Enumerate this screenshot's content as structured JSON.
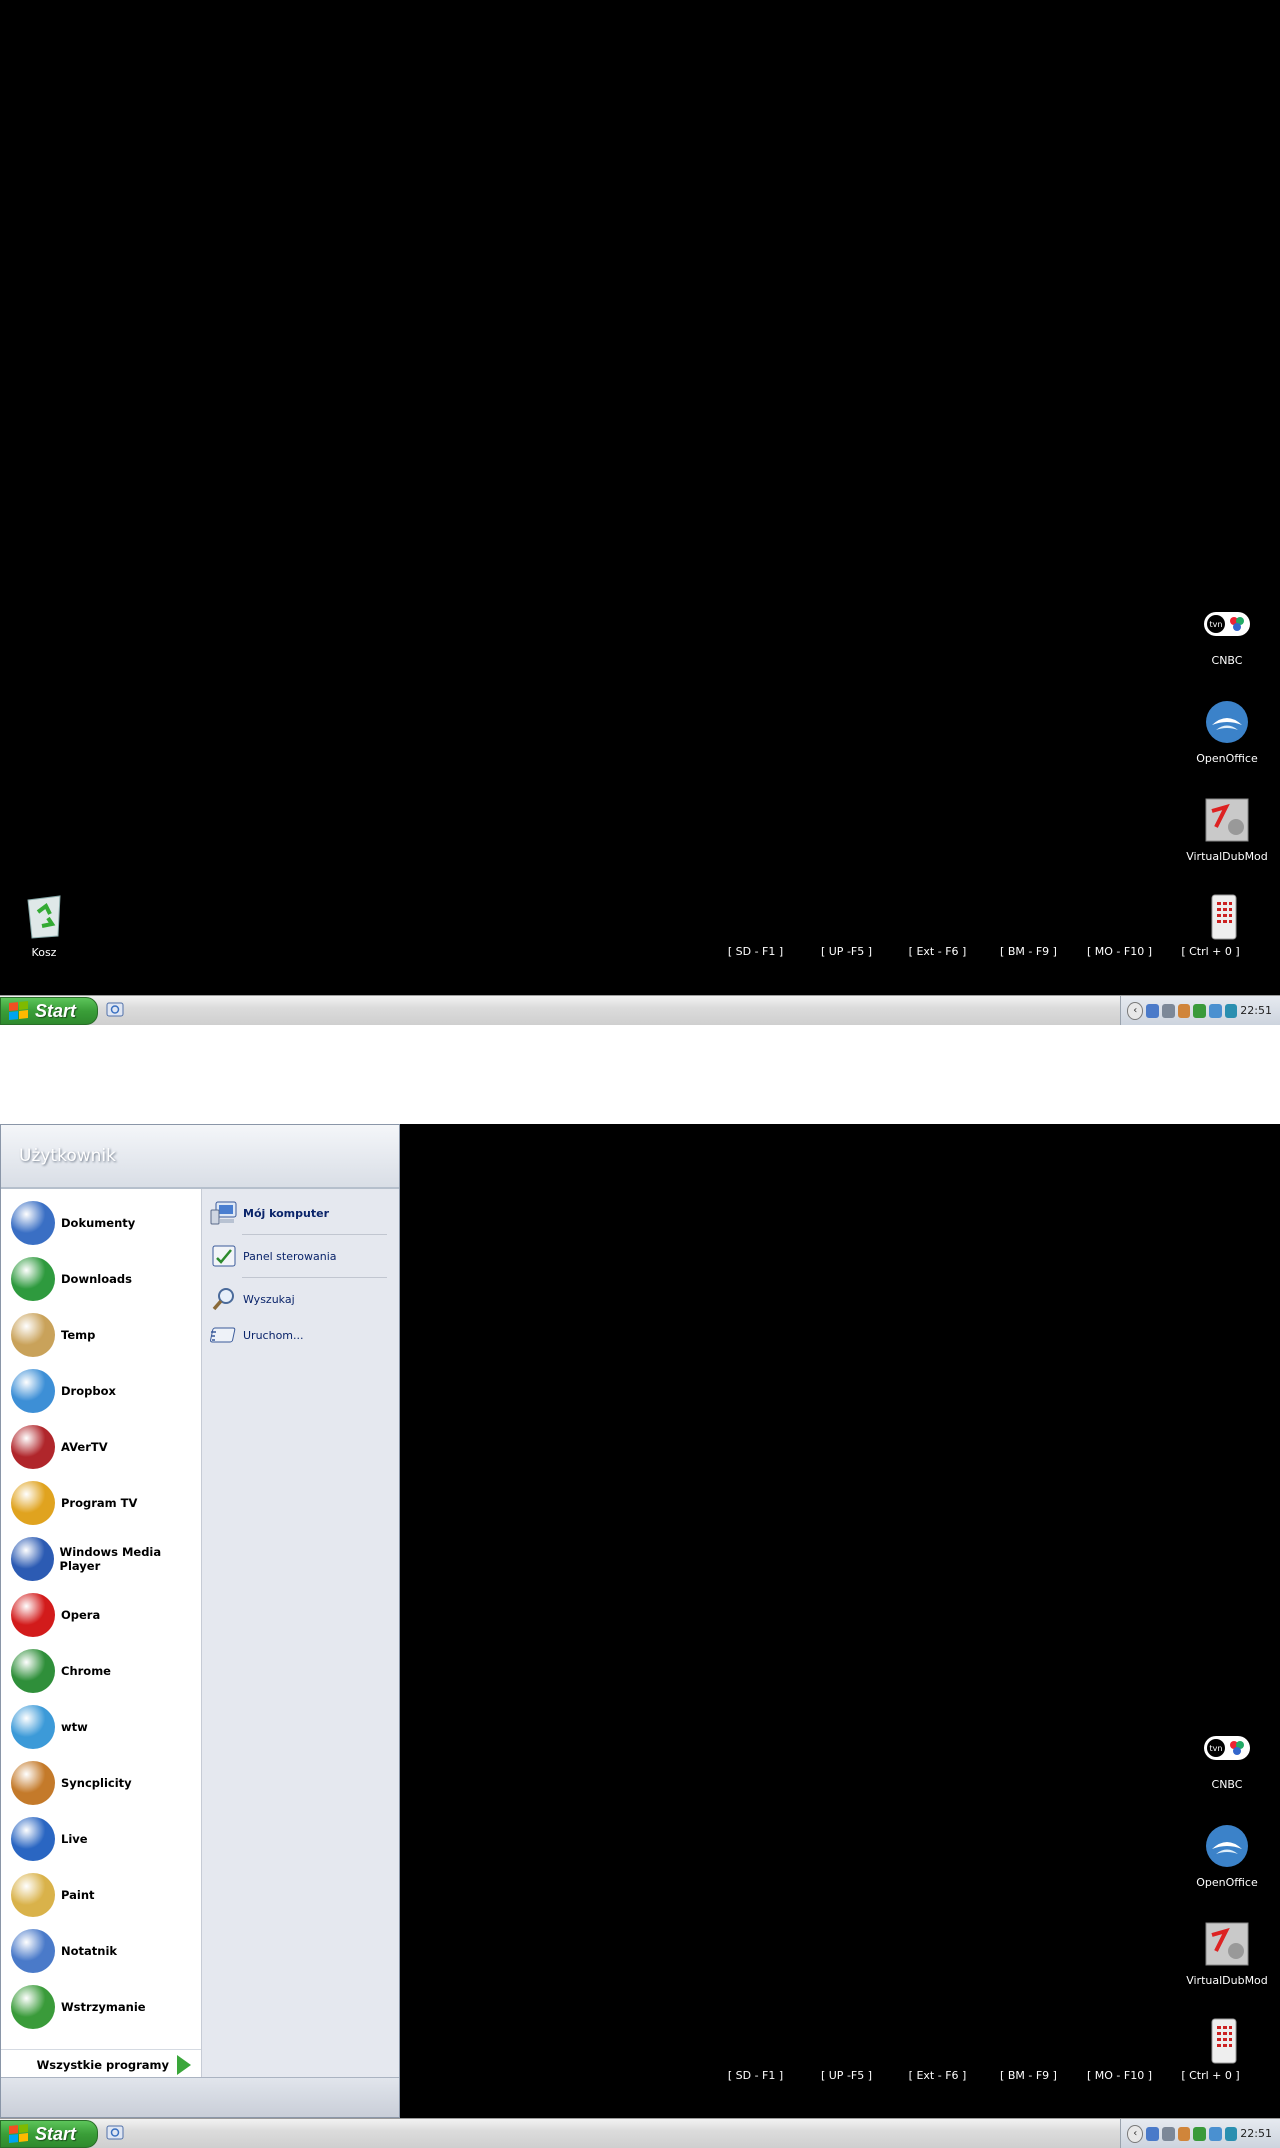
{
  "desktop": {
    "icons": [
      {
        "label": "CNBC",
        "icon": "tvn-cnbc-icon"
      },
      {
        "label": "OpenOffice",
        "icon": "openoffice-icon"
      },
      {
        "label": "VirtualDubMod",
        "icon": "virtualdubmod-icon"
      },
      {
        "label": "Kosz",
        "icon": "recycle-bin-icon"
      }
    ],
    "hotkeys": [
      "[ SD - F1 ]",
      "[ UP -F5 ]",
      "[ Ext - F6 ]",
      "[ BM - F9 ]",
      "[ MO - F10 ]",
      "[ Ctrl + 0 ]"
    ]
  },
  "taskbar": {
    "start_label": "Start",
    "clock": "22:51"
  },
  "start_menu": {
    "user": "Użytkownik",
    "programs": [
      {
        "label": "Dokumenty",
        "icon": "documents-icon",
        "color": "#3a6fc4"
      },
      {
        "label": "Downloads",
        "icon": "downloads-icon",
        "color": "#2e9a3e"
      },
      {
        "label": "Temp",
        "icon": "hourglass-icon",
        "color": "#c9a25a"
      },
      {
        "label": "Dropbox",
        "icon": "dropbox-icon",
        "color": "#3d8fd6"
      },
      {
        "label": "AVerTV",
        "icon": "avertv-icon",
        "color": "#b0262b"
      },
      {
        "label": "Program TV",
        "icon": "program-tv-icon",
        "color": "#e0a31f"
      },
      {
        "label": "Windows Media Player",
        "icon": "media-player-icon",
        "color": "#2c5bb3"
      },
      {
        "label": "Opera",
        "icon": "opera-icon",
        "color": "#d21b1b"
      },
      {
        "label": "Chrome",
        "icon": "chrome-icon",
        "color": "#2f8f3a"
      },
      {
        "label": "wtw",
        "icon": "wtw-icon",
        "color": "#3c9ad8"
      },
      {
        "label": "Syncplicity",
        "icon": "syncplicity-icon",
        "color": "#c47a2a"
      },
      {
        "label": "Live",
        "icon": "windows-live-icon",
        "color": "#2a66c2"
      },
      {
        "label": "Paint",
        "icon": "paint-icon",
        "color": "#d9b24a"
      },
      {
        "label": "Notatnik",
        "icon": "notepad-icon",
        "color": "#4a7ac9"
      },
      {
        "label": "Wstrzymanie",
        "icon": "hibernate-icon",
        "color": "#3a9b3a"
      }
    ],
    "all_programs": "Wszystkie programy",
    "places": [
      {
        "label": "Mój komputer",
        "icon": "my-computer-icon",
        "bold": true
      },
      {
        "label": "Panel sterowania",
        "icon": "control-panel-icon",
        "bold": false
      },
      {
        "label": "Wyszukaj",
        "icon": "search-icon",
        "bold": false
      },
      {
        "label": "Uruchom...",
        "icon": "run-icon",
        "bold": false
      }
    ]
  }
}
